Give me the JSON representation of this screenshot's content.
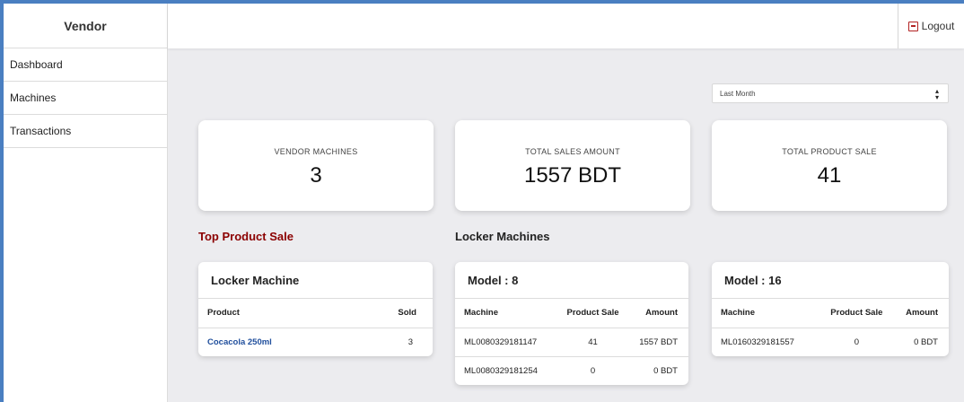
{
  "sidebar": {
    "brand": "Vendor",
    "items": [
      {
        "label": "Dashboard"
      },
      {
        "label": "Machines"
      },
      {
        "label": "Transactions"
      }
    ]
  },
  "topbar": {
    "logout_label": "Logout",
    "logout_icon": "logout-icon"
  },
  "filter": {
    "selected": "Last Month"
  },
  "stats": [
    {
      "label": "VENDOR MACHINES",
      "value": "3"
    },
    {
      "label": "TOTAL SALES AMOUNT",
      "value": "1557 BDT"
    },
    {
      "label": "TOTAL PRODUCT SALE",
      "value": "41"
    }
  ],
  "sections": {
    "top_product": "Top Product Sale",
    "locker_machines": "Locker Machines"
  },
  "top_product_card": {
    "title": "Locker Machine",
    "columns": [
      "Product",
      "Sold"
    ],
    "rows": [
      {
        "product": "Cocacola 250ml",
        "sold": "3"
      }
    ]
  },
  "models": [
    {
      "title": "Model : 8",
      "columns": [
        "Machine",
        "Product Sale",
        "Amount"
      ],
      "rows": [
        {
          "machine": "ML0080329181147",
          "sale": "41",
          "amount": "1557 BDT"
        },
        {
          "machine": "ML0080329181254",
          "sale": "0",
          "amount": "0 BDT"
        }
      ]
    },
    {
      "title": "Model : 16",
      "columns": [
        "Machine",
        "Product Sale",
        "Amount"
      ],
      "rows": [
        {
          "machine": "ML0160329181557",
          "sale": "0",
          "amount": "0 BDT"
        }
      ]
    }
  ],
  "colors": {
    "accent_red": "#8b0000",
    "link_blue": "#1f4e9c",
    "frame_blue": "#4a7fc1"
  }
}
